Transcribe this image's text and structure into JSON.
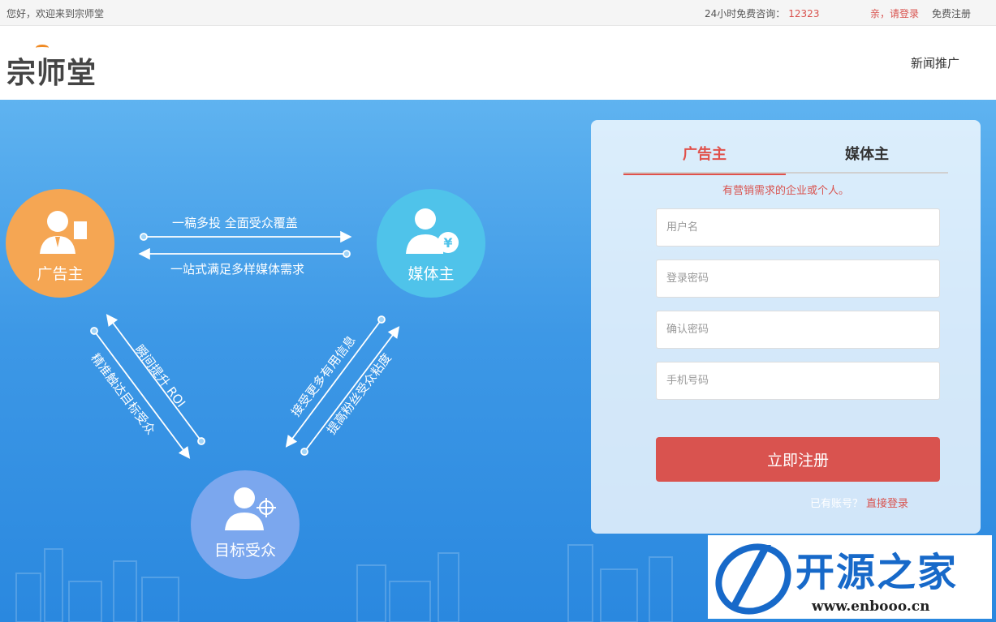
{
  "topbar": {
    "welcome": "您好，欢迎来到宗师堂",
    "hotline_label": "24小时免费咨询：",
    "hotline_number": "12323",
    "login": "亲，请登录",
    "register": "免费注册"
  },
  "header": {
    "logo": "宗师堂",
    "nav_news": "新闻推广"
  },
  "diagram": {
    "advertiser": "广告主",
    "media": "媒体主",
    "audience": "目标受众",
    "top_forward": "一稿多投  全面受众覆盖",
    "top_backward": "一站式满足多样媒体需求",
    "left_up": "瞬间提升 ROI",
    "left_down": "精准触达目标受众",
    "right_up": "接受更多有用信息",
    "right_down": "提高粉丝受众粘度"
  },
  "form": {
    "tab_adv": "广告主",
    "tab_media": "媒体主",
    "tagline": "有营销需求的企业或个人。",
    "username_placeholder": "用户名",
    "password_placeholder": "登录密码",
    "confirm_placeholder": "确认密码",
    "phone_placeholder": "手机号码",
    "submit": "立即注册",
    "have_account": "已有账号？",
    "direct_login": "直接登录"
  },
  "watermark": {
    "text": "开源之家",
    "url": "www.enbooo.cn"
  },
  "colors": {
    "accent_red": "#d9534f",
    "advertiser_orange": "#f5a653",
    "media_cyan": "#4fc3ea",
    "audience_blue": "#7ba7ee",
    "hero_blue": "#3d98e6"
  }
}
